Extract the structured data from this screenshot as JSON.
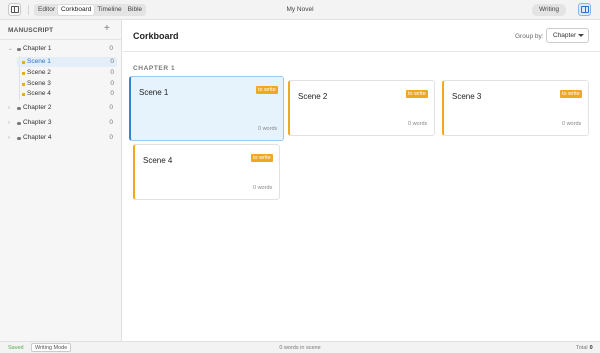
{
  "topbar": {
    "tabs": [
      {
        "label": "Editor"
      },
      {
        "label": "Corkboard"
      },
      {
        "label": "Timeline"
      },
      {
        "label": "Bible"
      }
    ],
    "active_tab": "Corkboard",
    "title": "My Novel",
    "mode_button": "Writing"
  },
  "sidebar": {
    "title": "MANUSCRIPT",
    "add_label": "+",
    "chapters": [
      {
        "label": "Chapter 1",
        "count": "0",
        "expanded": true,
        "scenes": [
          {
            "label": "Scene 1",
            "count": "0",
            "selected": true
          },
          {
            "label": "Scene 2",
            "count": "0"
          },
          {
            "label": "Scene 3",
            "count": "0"
          },
          {
            "label": "Scene 4",
            "count": "0"
          }
        ]
      },
      {
        "label": "Chapter 2",
        "count": "0",
        "expanded": false
      },
      {
        "label": "Chapter 3",
        "count": "0",
        "expanded": false
      },
      {
        "label": "Chapter 4",
        "count": "0",
        "expanded": false
      }
    ]
  },
  "main": {
    "title": "Corkboard",
    "group_by_label": "Group by:",
    "group_by_value": "Chapter",
    "chapter_heading": "CHAPTER 1",
    "cards": [
      {
        "name": "Scene 1",
        "status": "to write",
        "words": "0 words",
        "selected": true
      },
      {
        "name": "Scene 2",
        "status": "to write",
        "words": "0 words"
      },
      {
        "name": "Scene 3",
        "status": "to write",
        "words": "0 words"
      },
      {
        "name": "Scene 4",
        "status": "to write",
        "words": "0 words"
      }
    ]
  },
  "statusbar": {
    "saved": "Saved",
    "writing_mode": "Writing Mode",
    "words_in_scene": "0 words in scene",
    "total_label": "Total",
    "total_value": "0"
  },
  "colors": {
    "accent": "#2f86d6",
    "status_to_write": "#f0a820",
    "saved": "#4caf50"
  }
}
